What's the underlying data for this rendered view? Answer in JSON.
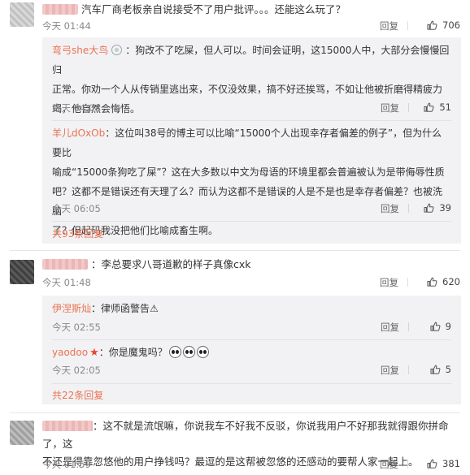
{
  "comments": [
    {
      "text": "汽车厂商老板亲自说接受不了用户批评。。。还能这么玩了？",
      "time": "今天 01:44",
      "reply_label": "回复",
      "likes": "706",
      "replies": [
        {
          "user": "弯弓she大鸟",
          "lines": [
            "：狗改不了吃屎，但人可以。时间会证明，这15000人中，大部分会慢慢回归",
            "正常。你劝一个人从传销里逃出来，不仅没效果，搞不好还挨骂，不如让他被折磨得精疲力",
            "竭，他自然会悔悟。"
          ],
          "time": "今天 04:08",
          "reply_label": "回复",
          "likes": "51"
        },
        {
          "user": "羊儿dOxOb",
          "lines": [
            "：这位叫38号的博主可以比喻“15000个人出现幸存者偏差的例子”，但为什么要比",
            "喻成“15000条狗吃了屎”？这在大多数以中文为母语的环境里都会普遍被认为是带侮辱性质",
            "吧？这都不是错误还有天理了么？而认为这都不是错误的人是不是也是幸存者偏差？也被洗脑",
            "了？但起码我没把他们比喻成畜生啊。"
          ],
          "time": "今天 06:05",
          "reply_label": "回复",
          "likes": "39"
        }
      ],
      "more": "共93条回复"
    },
    {
      "text": "：李总要求八哥道歉的样子真像cxk",
      "time": "今天 01:48",
      "reply_label": "回复",
      "likes": "620",
      "replies": [
        {
          "user": "伊涅斯灿",
          "lines": [
            "：律师函警告⚠"
          ],
          "time": "今天 02:55",
          "reply_label": "回复",
          "likes": "9"
        },
        {
          "user": "yaodoo",
          "lines": [
            "：你是魔鬼吗？"
          ],
          "time": "今天 02:05",
          "reply_label": "回复",
          "likes": "5"
        }
      ],
      "more": "共22条回复"
    },
    {
      "lines": [
        "：这不就是流氓嘛，你说我车不好我不反驳，你说我用户不好那我就得跟你拼命了，这",
        "不还是得靠忽悠他的用户挣钱吗？最逗的是这帮被忽悠的还感动的要帮人家一起上。"
      ],
      "time": "今天 01:59",
      "reply_label": "回复",
      "likes": "381"
    }
  ],
  "colors": {
    "username": "#eb7350",
    "reply_bg": "#f2f2f5"
  },
  "icons": [
    "thumb-up-icon",
    "verified-badge-icon",
    "star-badge-icon",
    "ghost-emoji-icon"
  ]
}
